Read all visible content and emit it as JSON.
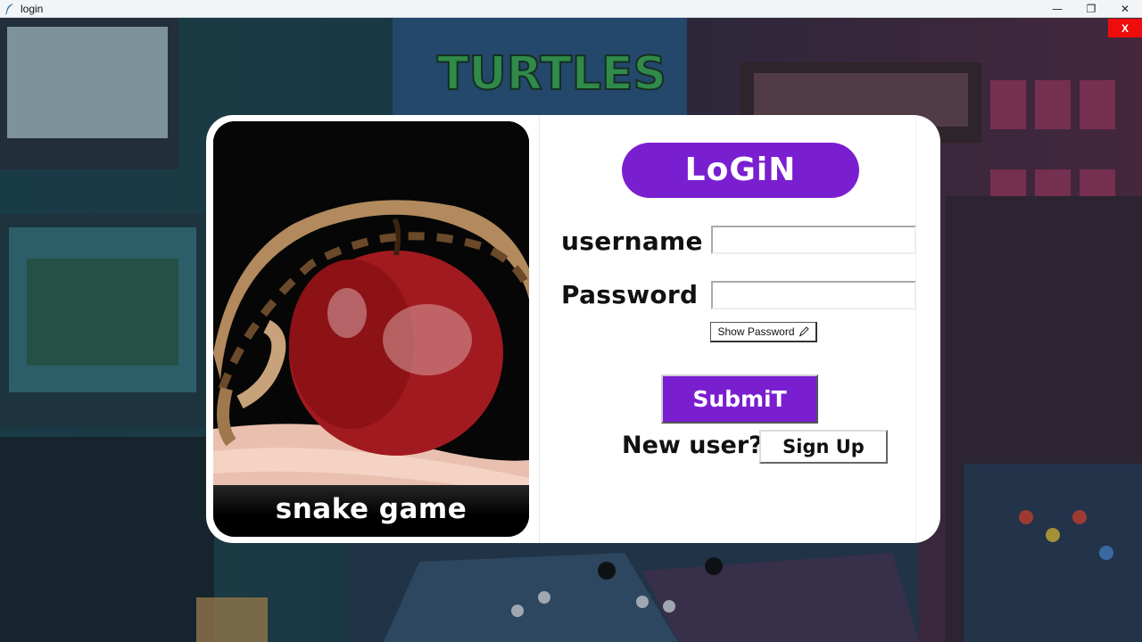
{
  "window": {
    "title": "login",
    "minimize_glyph": "—",
    "maximize_glyph": "❐",
    "close_glyph": "✕",
    "app_icon": "feather-icon"
  },
  "app_close_button": "X",
  "image_panel": {
    "caption": "snake game",
    "image": "snake-coiled-on-apple"
  },
  "form": {
    "heading": "LoGiN",
    "username_label": "username",
    "password_label": "Password",
    "username_value": "",
    "password_value": "",
    "show_password_label": "Show Password",
    "show_password_icon": "pencil-icon",
    "submit_label": "SubmiT",
    "new_user_text": "New user?",
    "signup_label": "Sign Up"
  },
  "colors": {
    "accent_purple": "#7a1fd0",
    "close_red": "#ee0c0c",
    "card_bg": "#ffffff"
  }
}
